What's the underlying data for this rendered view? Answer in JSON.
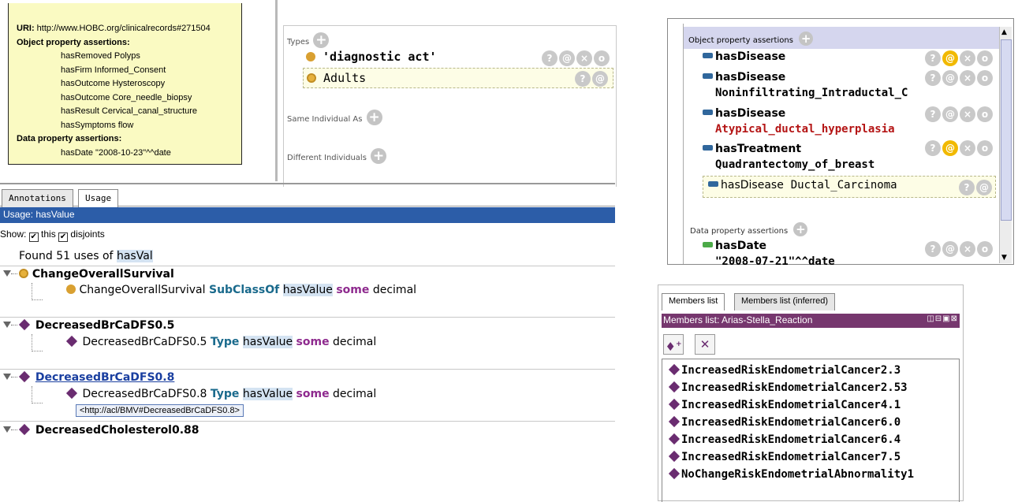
{
  "uri_box": {
    "uri_label": "URI:",
    "uri_value": "http://www.HOBC.org/clinicalrecords#271504",
    "object_header": "Object property assertions:",
    "object_items": [
      {
        "prop": "hasRemoved",
        "value": "Polyps"
      },
      {
        "prop": "hasFirm",
        "value": "Informed_Consent"
      },
      {
        "prop": "hasOutcome",
        "value": "Hysteroscopy"
      },
      {
        "prop": "hasOutcome",
        "value": "Core_needle_biopsy"
      },
      {
        "prop": "hasResult",
        "value": "Cervical_canal_structure"
      },
      {
        "prop": "hasSymptoms",
        "value": "flow"
      }
    ],
    "data_header": "Data property assertions:",
    "data_items": [
      {
        "prop": "hasDate",
        "value": "\"2008-10-23\"^^date"
      }
    ]
  },
  "types_panel": {
    "types_label": "Types",
    "types": [
      {
        "label": "'diagnostic act'",
        "buttons": [
          "?",
          "@",
          "×",
          "o"
        ]
      },
      {
        "label": "Adults",
        "buttons": [
          "?",
          "@"
        ]
      }
    ],
    "same_individual_label": "Same Individual As",
    "different_individuals_label": "Different Individuals"
  },
  "usage_panel": {
    "tabs": [
      "Annotations",
      "Usage"
    ],
    "header": "Usage: hasValue",
    "show_label": "Show:",
    "show_this": "this",
    "show_disjoints": "disjoints",
    "found_prefix": "Found 51 uses of",
    "found_term": "hasVal",
    "groups": [
      {
        "head": "ChangeOverallSurvival",
        "icon": "class",
        "sub": {
          "subject": "ChangeOverallSurvival",
          "kw1": "SubClassOf",
          "prop": "hasValue",
          "kw2": "some",
          "rest": "decimal"
        }
      },
      {
        "head": "DecreasedBrCaDFS0.5",
        "icon": "individual",
        "sub": {
          "subject": "DecreasedBrCaDFS0.5",
          "kw1": "Type",
          "prop": "hasValue",
          "kw2": "some",
          "rest": "decimal"
        }
      },
      {
        "head": "DecreasedBrCaDFS0.8",
        "icon": "individual",
        "sub": {
          "subject": "DecreasedBrCaDFS0.8",
          "kw1": "Type",
          "prop": "hasValue",
          "kw2": "some",
          "rest": "decimal"
        }
      },
      {
        "head": "DecreasedCholesterol0.88",
        "icon": "individual"
      }
    ],
    "tooltip": "<http://acl/BMV#DecreasedBrCaDFS0.8>"
  },
  "object_property_panel": {
    "header": "Object property assertions",
    "items": [
      {
        "prop": "hasDisease",
        "value": "",
        "style": "normal"
      },
      {
        "prop": "hasDisease",
        "value": "Noninfiltrating_Intraductal_C",
        "style": "normal"
      },
      {
        "prop": "hasDisease",
        "value": "Atypical_ductal_hyperplasia",
        "style": "red"
      },
      {
        "prop": "hasTreatment",
        "value": "Quadrantectomy_of_breast",
        "style": "normal"
      },
      {
        "prop": "hasDisease",
        "value": "Ductal_Carcinoma",
        "style": "highlight"
      }
    ],
    "data_header": "Data property assertions",
    "data_items": [
      {
        "prop": "hasDate",
        "value": "\"2008-07-21\"^^date"
      }
    ]
  },
  "members_panel": {
    "tabs": [
      "Members list",
      "Members list (inferred)"
    ],
    "header": "Members list: Arias-Stella_Reaction",
    "window_icons": "◫⊟▣⊠",
    "members": [
      "IncreasedRiskEndometrialCancer2.3",
      "IncreasedRiskEndometrialCancer2.53",
      "IncreasedRiskEndometrialCancer4.1",
      "IncreasedRiskEndometrialCancer6.0",
      "IncreasedRiskEndometrialCancer6.4",
      "IncreasedRiskEndometrialCancer7.5",
      "NoChangeRiskEndometrialAbnormality1"
    ]
  },
  "colors": {
    "uri_box_bg": "#fafac2",
    "usage_header_bg": "#2c5da8",
    "members_header_bg": "#76376e",
    "object_header_bg": "#d5d6ee",
    "individual_icon": "#6a2c70",
    "class_icon": "#d9a031",
    "object_prop_icon": "#30679c",
    "data_prop_icon": "#4caa48",
    "highlight_button": "#f1b900"
  }
}
